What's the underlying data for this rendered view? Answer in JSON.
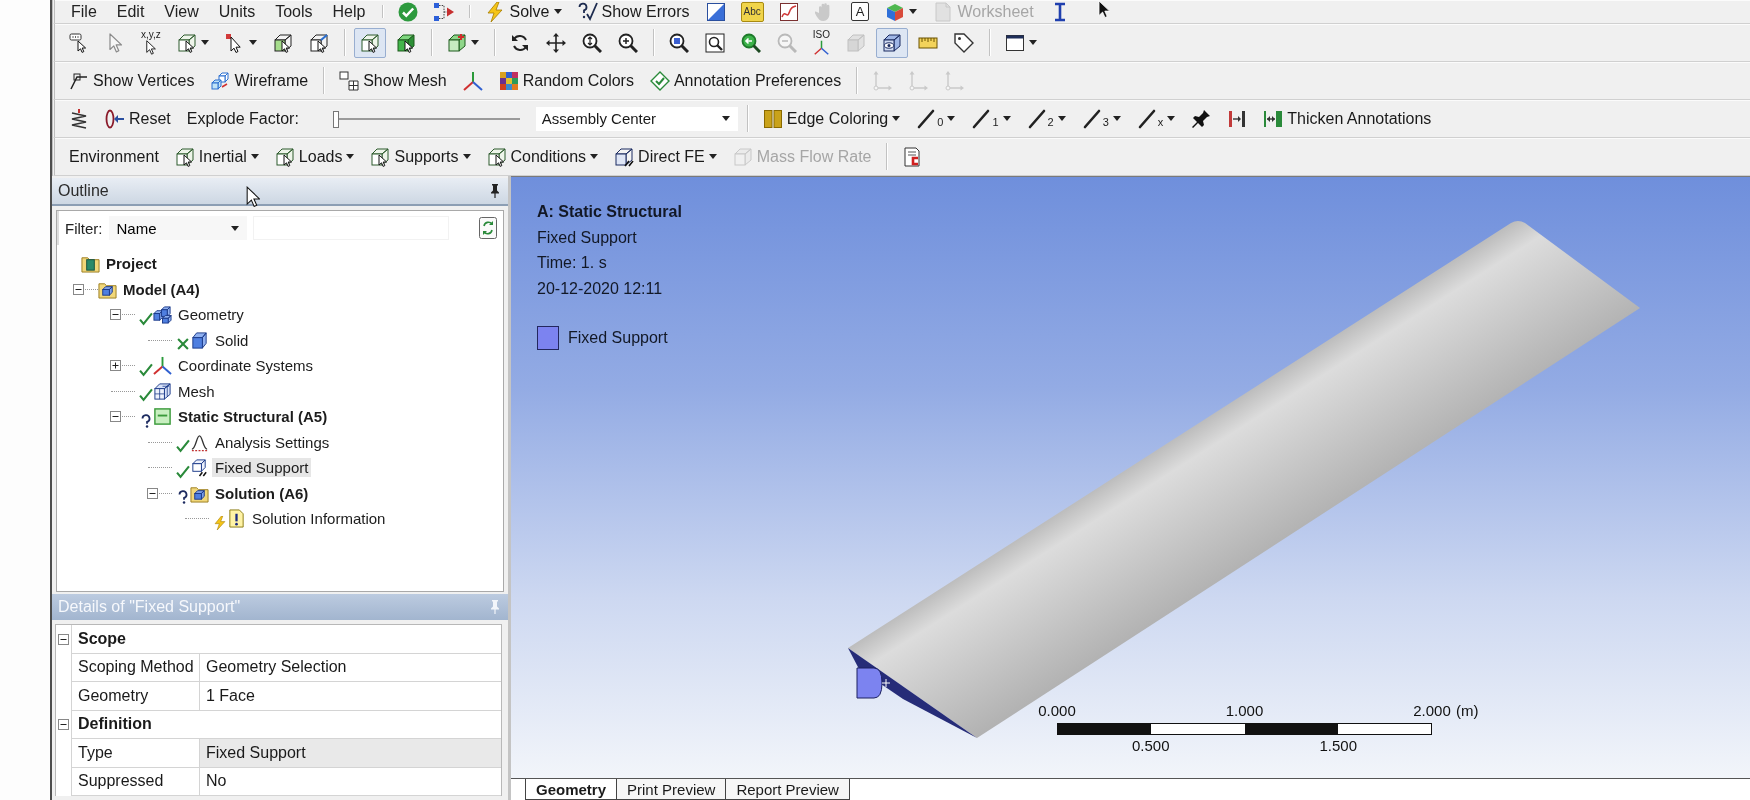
{
  "menu_bar": {
    "items": [
      "File",
      "Edit",
      "View",
      "Units",
      "Tools",
      "Help"
    ]
  },
  "toolbars": [
    {
      "groups": [
        [
          {
            "kind": "icon",
            "disabled": false
          },
          {
            "kind": "icon",
            "disabled": false
          }
        ],
        [
          {
            "kind": "menubutton",
            "label": "Solve",
            "disabled": false
          },
          {
            "kind": "button",
            "label": "Show Errors",
            "disabled": false
          },
          {
            "kind": "icon",
            "disabled": false
          },
          {
            "kind": "icon",
            "badge": "Abc",
            "disabled": false
          },
          {
            "kind": "icon",
            "disabled": false
          },
          {
            "kind": "icon",
            "disabled": true
          },
          {
            "kind": "icon",
            "badge": "A",
            "disabled": false
          },
          {
            "kind": "iconmenu",
            "disabled": false
          },
          {
            "kind": "button",
            "label": "Worksheet",
            "disabled": true
          },
          {
            "kind": "icon",
            "disabled": false
          }
        ]
      ]
    },
    {
      "groups": [
        [
          {
            "kind": "icon",
            "disabled": false,
            "pressed": false
          },
          {
            "kind": "icon",
            "disabled": true,
            "pressed": false
          },
          {
            "kind": "icon",
            "badge": "x,y,z",
            "disabled": false,
            "pressed": false
          },
          {
            "kind": "iconmenu",
            "disabled": false,
            "pressed": false
          },
          {
            "kind": "iconmenu",
            "disabled": false,
            "pressed": false
          },
          {
            "kind": "icon",
            "disabled": false,
            "pressed": false
          },
          {
            "kind": "icon",
            "disabled": false,
            "pressed": false
          }
        ],
        [
          {
            "kind": "icon",
            "disabled": false,
            "pressed": true
          },
          {
            "kind": "icon",
            "disabled": false,
            "pressed": false
          }
        ],
        [
          {
            "kind": "iconmenu",
            "disabled": false,
            "pressed": false
          }
        ],
        [
          {
            "kind": "icon",
            "disabled": false,
            "pressed": false
          },
          {
            "kind": "icon",
            "disabled": false,
            "pressed": false
          },
          {
            "kind": "icon",
            "disabled": false,
            "pressed": false
          },
          {
            "kind": "icon",
            "disabled": false,
            "pressed": false
          }
        ],
        [
          {
            "kind": "icon",
            "disabled": false,
            "pressed": false
          },
          {
            "kind": "icon",
            "disabled": false,
            "pressed": false
          },
          {
            "kind": "icon",
            "disabled": false,
            "pressed": false
          },
          {
            "kind": "icon",
            "disabled": true,
            "pressed": false
          },
          {
            "kind": "icon",
            "badge": "ISO",
            "disabled": false,
            "pressed": false
          },
          {
            "kind": "icon",
            "disabled": true,
            "pressed": false
          },
          {
            "kind": "icon",
            "disabled": false,
            "pressed": true
          },
          {
            "kind": "icon",
            "disabled": false,
            "pressed": false
          },
          {
            "kind": "icon",
            "disabled": false,
            "pressed": false
          }
        ],
        [
          {
            "kind": "iconmenu",
            "disabled": false,
            "pressed": false
          }
        ]
      ]
    },
    {
      "groups": [
        [
          {
            "kind": "button",
            "label": "Show Vertices",
            "disabled": false
          },
          {
            "kind": "button",
            "label": "Wireframe",
            "disabled": false
          }
        ],
        [
          {
            "kind": "button",
            "label": "Show Mesh",
            "disabled": false
          },
          {
            "kind": "icon",
            "disabled": false
          },
          {
            "kind": "button",
            "label": "Random Colors",
            "disabled": false
          },
          {
            "kind": "button",
            "label": "Annotation Preferences",
            "disabled": false
          }
        ],
        [
          {
            "kind": "icon",
            "disabled": true
          },
          {
            "kind": "icon",
            "disabled": true
          },
          {
            "kind": "icon",
            "disabled": true
          }
        ]
      ]
    },
    {
      "groups": [
        [
          {
            "kind": "icon",
            "disabled": false
          },
          {
            "kind": "button",
            "label": "Reset",
            "disabled": false
          },
          {
            "kind": "label",
            "label": "Explode Factor:"
          },
          {
            "kind": "slider",
            "level": 0
          },
          {
            "kind": "combo",
            "label": "Assembly Center"
          }
        ],
        [
          {
            "kind": "menubutton",
            "label": "Edge Coloring",
            "disabled": false
          },
          {
            "kind": "iconmenu",
            "badge": "0",
            "disabled": false
          },
          {
            "kind": "iconmenu",
            "badge": "1",
            "disabled": false
          },
          {
            "kind": "iconmenu",
            "badge": "2",
            "disabled": false
          },
          {
            "kind": "iconmenu",
            "badge": "3",
            "disabled": false
          },
          {
            "kind": "iconmenu",
            "badge": "x",
            "disabled": false
          },
          {
            "kind": "icon",
            "disabled": false
          },
          {
            "kind": "icon",
            "disabled": false
          },
          {
            "kind": "button",
            "label": "Thicken Annotations",
            "disabled": false
          }
        ]
      ]
    },
    {
      "groups": [
        [
          {
            "kind": "label",
            "label": "Environment"
          },
          {
            "kind": "menubutton",
            "label": "Inertial",
            "disabled": false
          },
          {
            "kind": "menubutton",
            "label": "Loads",
            "disabled": false
          },
          {
            "kind": "menubutton",
            "label": "Supports",
            "disabled": false
          },
          {
            "kind": "menubutton",
            "label": "Conditions",
            "disabled": false
          },
          {
            "kind": "menubutton",
            "label": "Direct FE",
            "disabled": false
          },
          {
            "kind": "button",
            "label": "Mass Flow Rate",
            "disabled": true
          }
        ],
        [
          {
            "kind": "icon",
            "disabled": false
          }
        ]
      ]
    }
  ],
  "outline": {
    "title": "Outline",
    "filter": {
      "label": "Filter:",
      "field": "Name"
    },
    "tree": [
      {
        "label": "Project",
        "kind": "project",
        "selected": false,
        "children": [
          {
            "label": "Model (A4)",
            "kind": "model",
            "expanded": true,
            "selected": false,
            "children": [
              {
                "label": "Geometry",
                "kind": "geometry",
                "status": {
                  "kind": "ok"
                },
                "expanded": true,
                "selected": false,
                "children": [
                  {
                    "label": "Solid",
                    "kind": "body",
                    "status": {
                      "kind": "crossed"
                    },
                    "selected": false
                  }
                ]
              },
              {
                "label": "Coordinate Systems",
                "kind": "coordinates",
                "status": {
                  "kind": "ok"
                },
                "expanded": false,
                "selected": false
              },
              {
                "label": "Mesh",
                "kind": "mesh",
                "status": {
                  "kind": "ok"
                },
                "selected": false
              },
              {
                "label": "Static Structural (A5)",
                "kind": "analysis",
                "status": {
                  "kind": "question"
                },
                "expanded": true,
                "selected": false,
                "children": [
                  {
                    "label": "Analysis Settings",
                    "kind": "settings",
                    "status": {
                      "kind": "ok"
                    },
                    "selected": false
                  },
                  {
                    "label": "Fixed Support",
                    "kind": "support",
                    "status": {
                      "kind": "ok"
                    },
                    "selected": true
                  },
                  {
                    "label": "Solution (A6)",
                    "kind": "solution",
                    "status": {
                      "kind": "question"
                    },
                    "expanded": true,
                    "selected": false,
                    "children": [
                      {
                        "label": "Solution Information",
                        "kind": "information",
                        "status": {
                          "kind": "pending"
                        },
                        "selected": false
                      }
                    ]
                  }
                ]
              }
            ]
          }
        ]
      }
    ]
  },
  "details": {
    "title": "Details of \"Fixed Support\"",
    "rows": [
      {
        "kind": "category",
        "label": "Scope",
        "expanded": true
      },
      {
        "kind": "property",
        "name": "Scoping Method",
        "value": "Geometry Selection",
        "readonly": false
      },
      {
        "kind": "property",
        "name": "Geometry",
        "value": "1 Face",
        "readonly": false
      },
      {
        "kind": "category",
        "label": "Definition",
        "expanded": true
      },
      {
        "kind": "property",
        "name": "Type",
        "value": "Fixed Support",
        "readonly": true
      },
      {
        "kind": "property",
        "name": "Suppressed",
        "value": "No",
        "readonly": false
      }
    ]
  },
  "viewport": {
    "title": "A: Static Structural",
    "lines": [
      "Fixed Support",
      "Time: 1. s",
      "20-12-2020 12:11"
    ],
    "legend": [
      {
        "label": "Fixed Support",
        "color": "#7c83f0"
      }
    ],
    "scale_bar": {
      "major_labels": [
        "0.000",
        "1.000",
        "2.000"
      ],
      "minor_labels": [
        "0.500",
        "1.500"
      ],
      "unit": "(m)"
    }
  },
  "view_tabs": [
    {
      "label": "Geometry",
      "selected": true
    },
    {
      "label": "Print Preview",
      "selected": false
    },
    {
      "label": "Report Preview",
      "selected": false
    }
  ]
}
